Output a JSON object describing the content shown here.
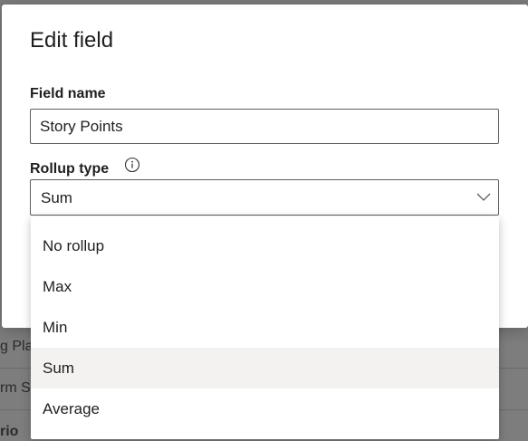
{
  "background": {
    "rows": [
      {
        "text": "g Pla"
      },
      {
        "text": "rm S"
      },
      {
        "text": "rio"
      }
    ]
  },
  "dialog": {
    "title": "Edit field",
    "field_name_label": "Field name",
    "field_name_value": "Story Points",
    "rollup_label": "Rollup type",
    "rollup_info_icon": "info-icon",
    "rollup_selected": "Sum",
    "chevron_icon": "chevron-down-icon"
  },
  "dropdown": {
    "options": [
      {
        "label": "No rollup"
      },
      {
        "label": "Max"
      },
      {
        "label": "Min"
      },
      {
        "label": "Sum"
      },
      {
        "label": "Average"
      }
    ],
    "selected": "Sum"
  },
  "colors": {
    "overlay": "#7d7d7d",
    "dialog_bg": "#ffffff",
    "text": "#201f1e",
    "border": "#605e5c",
    "selected_item_bg": "#f3f2f1"
  }
}
